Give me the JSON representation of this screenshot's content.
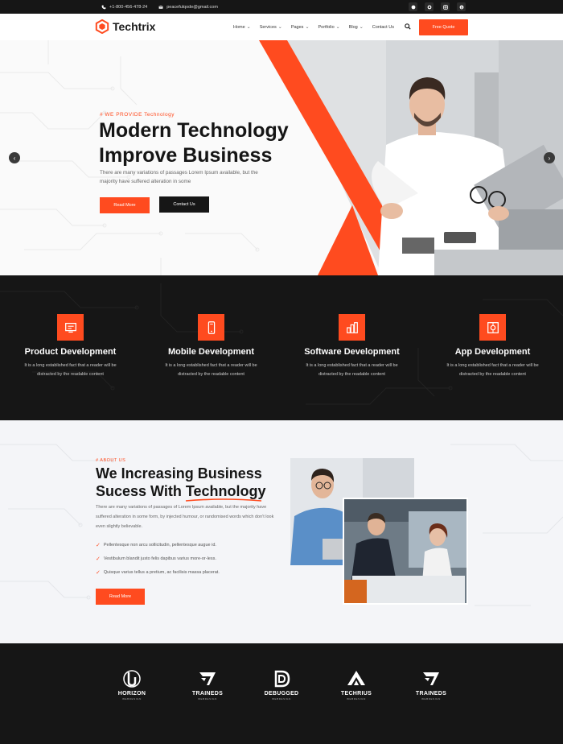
{
  "topbar": {
    "phone": "+1-800-456-478-24",
    "email": "peacefulqode@gmail.com",
    "socials": [
      "facebook-icon",
      "github-icon",
      "instagram-icon",
      "skype-icon"
    ]
  },
  "header": {
    "logo_text": "Techtrix",
    "nav": [
      "Home",
      "Services",
      "Pages",
      "Portfolio",
      "Blog",
      "Contact Us"
    ],
    "quote_button": "Free Quote"
  },
  "hero": {
    "tag": "# WE PROVIDE Technology",
    "title_line1": "Modern Technology",
    "title_line2": "Improve Business",
    "description": "There are many variations of passages Lorem Ipsum available, but the majority have suffered alteration in some",
    "primary_button": "Read More",
    "secondary_button": "Contact Us"
  },
  "services": [
    {
      "title": "Product Development",
      "text": "It is a long established fact that a reader will be distracted by the readable content"
    },
    {
      "title": "Mobile Development",
      "text": "It is a long established fact that a reader will be distracted by the readable content"
    },
    {
      "title": "Software Development",
      "text": "It is a long established fact that a reader will be distracted by the readable content"
    },
    {
      "title": "App Development",
      "text": "It is a long established fact that a reader will be distracted by the readable content"
    }
  ],
  "about": {
    "tag": "# ABOUT US",
    "title_line1": "We Increasing Business",
    "title_line2": "Sucess With Technology",
    "description": "There are many variations of passages of Lorem Ipsum available, but the majority have suffered alteration in some form, by injected humour, or randomised words which don't look even slightly believable.",
    "list": [
      "Pellentesque non arcu sollicitudin, pellentesque augue id.",
      "Vestibulum blandit justo felis dapibus varius more-or-less.",
      "Quisque varius tellus a pretium, ac facilisis massa placerat."
    ],
    "button": "Read More"
  },
  "brands": [
    {
      "name": "HORIZON",
      "sub": "WEBDESIGN"
    },
    {
      "name": "TRAINEDS",
      "sub": "WEBDESIGN"
    },
    {
      "name": "DEBUGGED",
      "sub": "WEBDESIGN"
    },
    {
      "name": "TECHRIUS",
      "sub": "WEBDESIGN"
    },
    {
      "name": "TRAINEDS",
      "sub": "WEBDESIGN"
    }
  ],
  "colors": {
    "accent": "#ff4b1f",
    "dark": "#161616",
    "light_bg": "#f4f5f8"
  }
}
